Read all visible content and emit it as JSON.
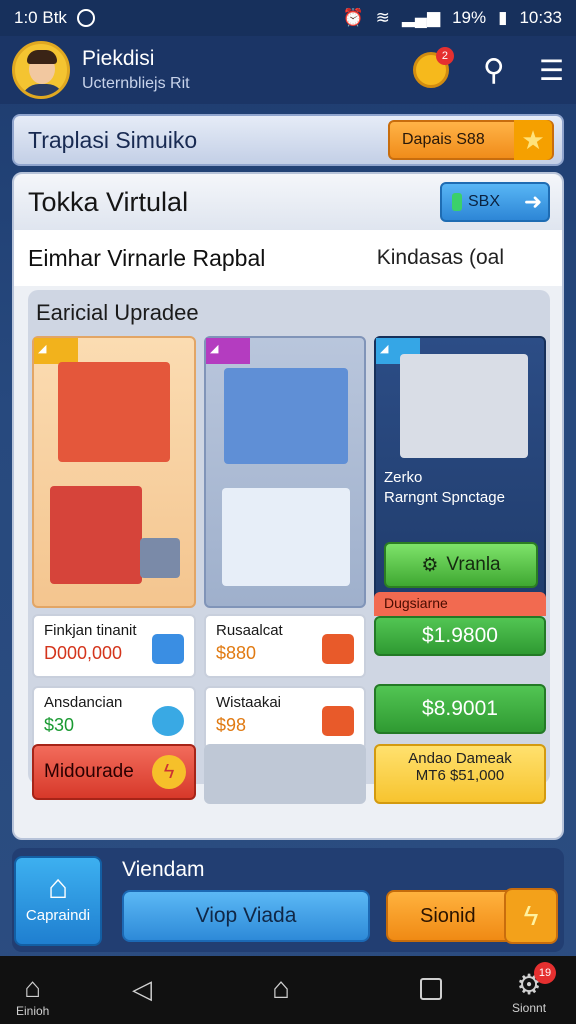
{
  "status": {
    "left": "1:0 Btk",
    "battery": "19%",
    "time": "10:33"
  },
  "header": {
    "name": "Piekdisi",
    "sub": "Ucternbliejs Rit",
    "coin_badge": "2"
  },
  "title_bar": {
    "title": "Traplasi Simuiko",
    "deposit": "Dapais S88"
  },
  "panel": {
    "title": "Tokka Virtulal",
    "sbx": "SBX",
    "subhead_left": "Eimhar Virnarle Rapbal",
    "subhead_right": "Kindasas (oal",
    "upgrades_label": "Earicial Upradee",
    "card3_text1": "Zerko",
    "card3_text2": "Rarngnt Spnctage",
    "card3_button": "Vranla",
    "box1_name": "Finkjan tinanit",
    "box1_value": "D000,000",
    "box2_name": "Rusaalcat",
    "box2_value": "$880",
    "box3_name": "Ansdancian",
    "box3_value": "$30",
    "box4_name": "Wistaakai",
    "box4_value": "$98",
    "orange_head": "Dugsiarne",
    "price1": "$1.9800",
    "price2": "$8.9001",
    "mod_button": "Midourade",
    "yellow_l1": "Andao Dameak",
    "yellow_l2": "MT6 $51,000"
  },
  "bottom": {
    "cap": "Capraindi",
    "label": "Viendam",
    "viop": "Viop Viada",
    "sionid": "Sionid"
  },
  "nav": {
    "home": "Einioh",
    "settings": "Sionnt",
    "badge": "19"
  },
  "colors": {
    "accent_orange": "#f08c1a",
    "accent_green": "#3fa832",
    "accent_blue": "#2d86d6"
  }
}
